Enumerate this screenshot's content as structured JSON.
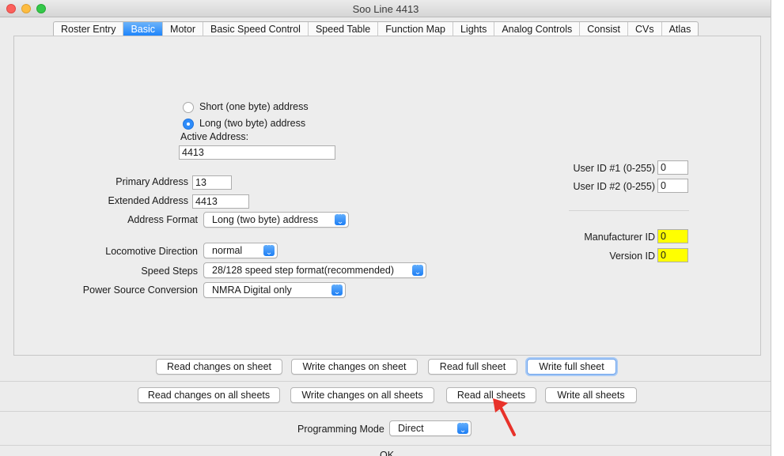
{
  "window": {
    "title": "Soo Line 4413"
  },
  "tabs": [
    {
      "label": "Roster Entry",
      "active": false
    },
    {
      "label": "Basic",
      "active": true
    },
    {
      "label": "Motor",
      "active": false
    },
    {
      "label": "Basic Speed Control",
      "active": false
    },
    {
      "label": "Speed Table",
      "active": false
    },
    {
      "label": "Function Map",
      "active": false
    },
    {
      "label": "Lights",
      "active": false
    },
    {
      "label": "Analog Controls",
      "active": false
    },
    {
      "label": "Consist",
      "active": false
    },
    {
      "label": "CVs",
      "active": false
    },
    {
      "label": "Atlas",
      "active": false
    }
  ],
  "address": {
    "short_label": "Short (one byte) address",
    "long_label": "Long (two byte) address",
    "selected": "long",
    "active_label": "Active Address:",
    "active_value": "4413"
  },
  "fields": {
    "primary_label": "Primary Address",
    "primary_value": "13",
    "extended_label": "Extended Address",
    "extended_value": "4413",
    "format_label": "Address Format",
    "format_value": "Long (two byte) address",
    "direction_label": "Locomotive Direction",
    "direction_value": "normal",
    "steps_label": "Speed Steps",
    "steps_value": "28/128 speed step format(recommended)",
    "power_label": "Power Source Conversion",
    "power_value": "NMRA Digital only"
  },
  "ids": {
    "user1_label": "User ID #1 (0-255)",
    "user1_value": "0",
    "user2_label": "User ID #2 (0-255)",
    "user2_value": "0",
    "manufacturer_label": "Manufacturer ID",
    "manufacturer_value": "0",
    "version_label": "Version ID",
    "version_value": "0"
  },
  "sheet_buttons": {
    "read_changes": "Read changes on sheet",
    "write_changes": "Write changes on sheet",
    "read_full": "Read full sheet",
    "write_full": "Write full sheet"
  },
  "all_buttons": {
    "read_changes_all": "Read changes on all sheets",
    "write_changes_all": "Write changes on all sheets",
    "read_all": "Read all sheets",
    "write_all": "Write all sheets"
  },
  "programming": {
    "label": "Programming Mode",
    "value": "Direct"
  },
  "footer": {
    "ok": "OK"
  },
  "colors": {
    "accent": "#1a82fb",
    "highlight_field": "#ffff00",
    "annotation_arrow": "#e8322a"
  },
  "icons": {
    "select_arrows": "chevron-updown-icon",
    "annotation": "red-arrow-icon"
  }
}
